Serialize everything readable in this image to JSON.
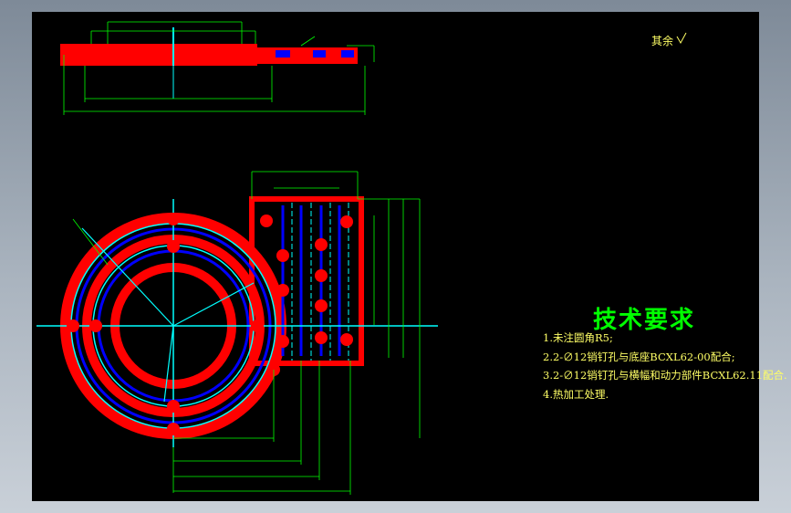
{
  "roughness_note": "其余",
  "technical_requirements": {
    "title": "技术要求",
    "items": [
      "1.未注圆角R5;",
      "2.2-∅12销钉孔与底座BCXL62-00配合;",
      "3.2-∅12销钉孔与横幅和动力部件BCXL62.11配合.",
      "4.热加工处理."
    ]
  },
  "colors": {
    "background": "#000000",
    "part_outline": "#ff0000",
    "center_lines": "#00ffff",
    "hidden_lines": "#0000ff",
    "dimensions": "#00ff00",
    "text": "#ffff66"
  }
}
